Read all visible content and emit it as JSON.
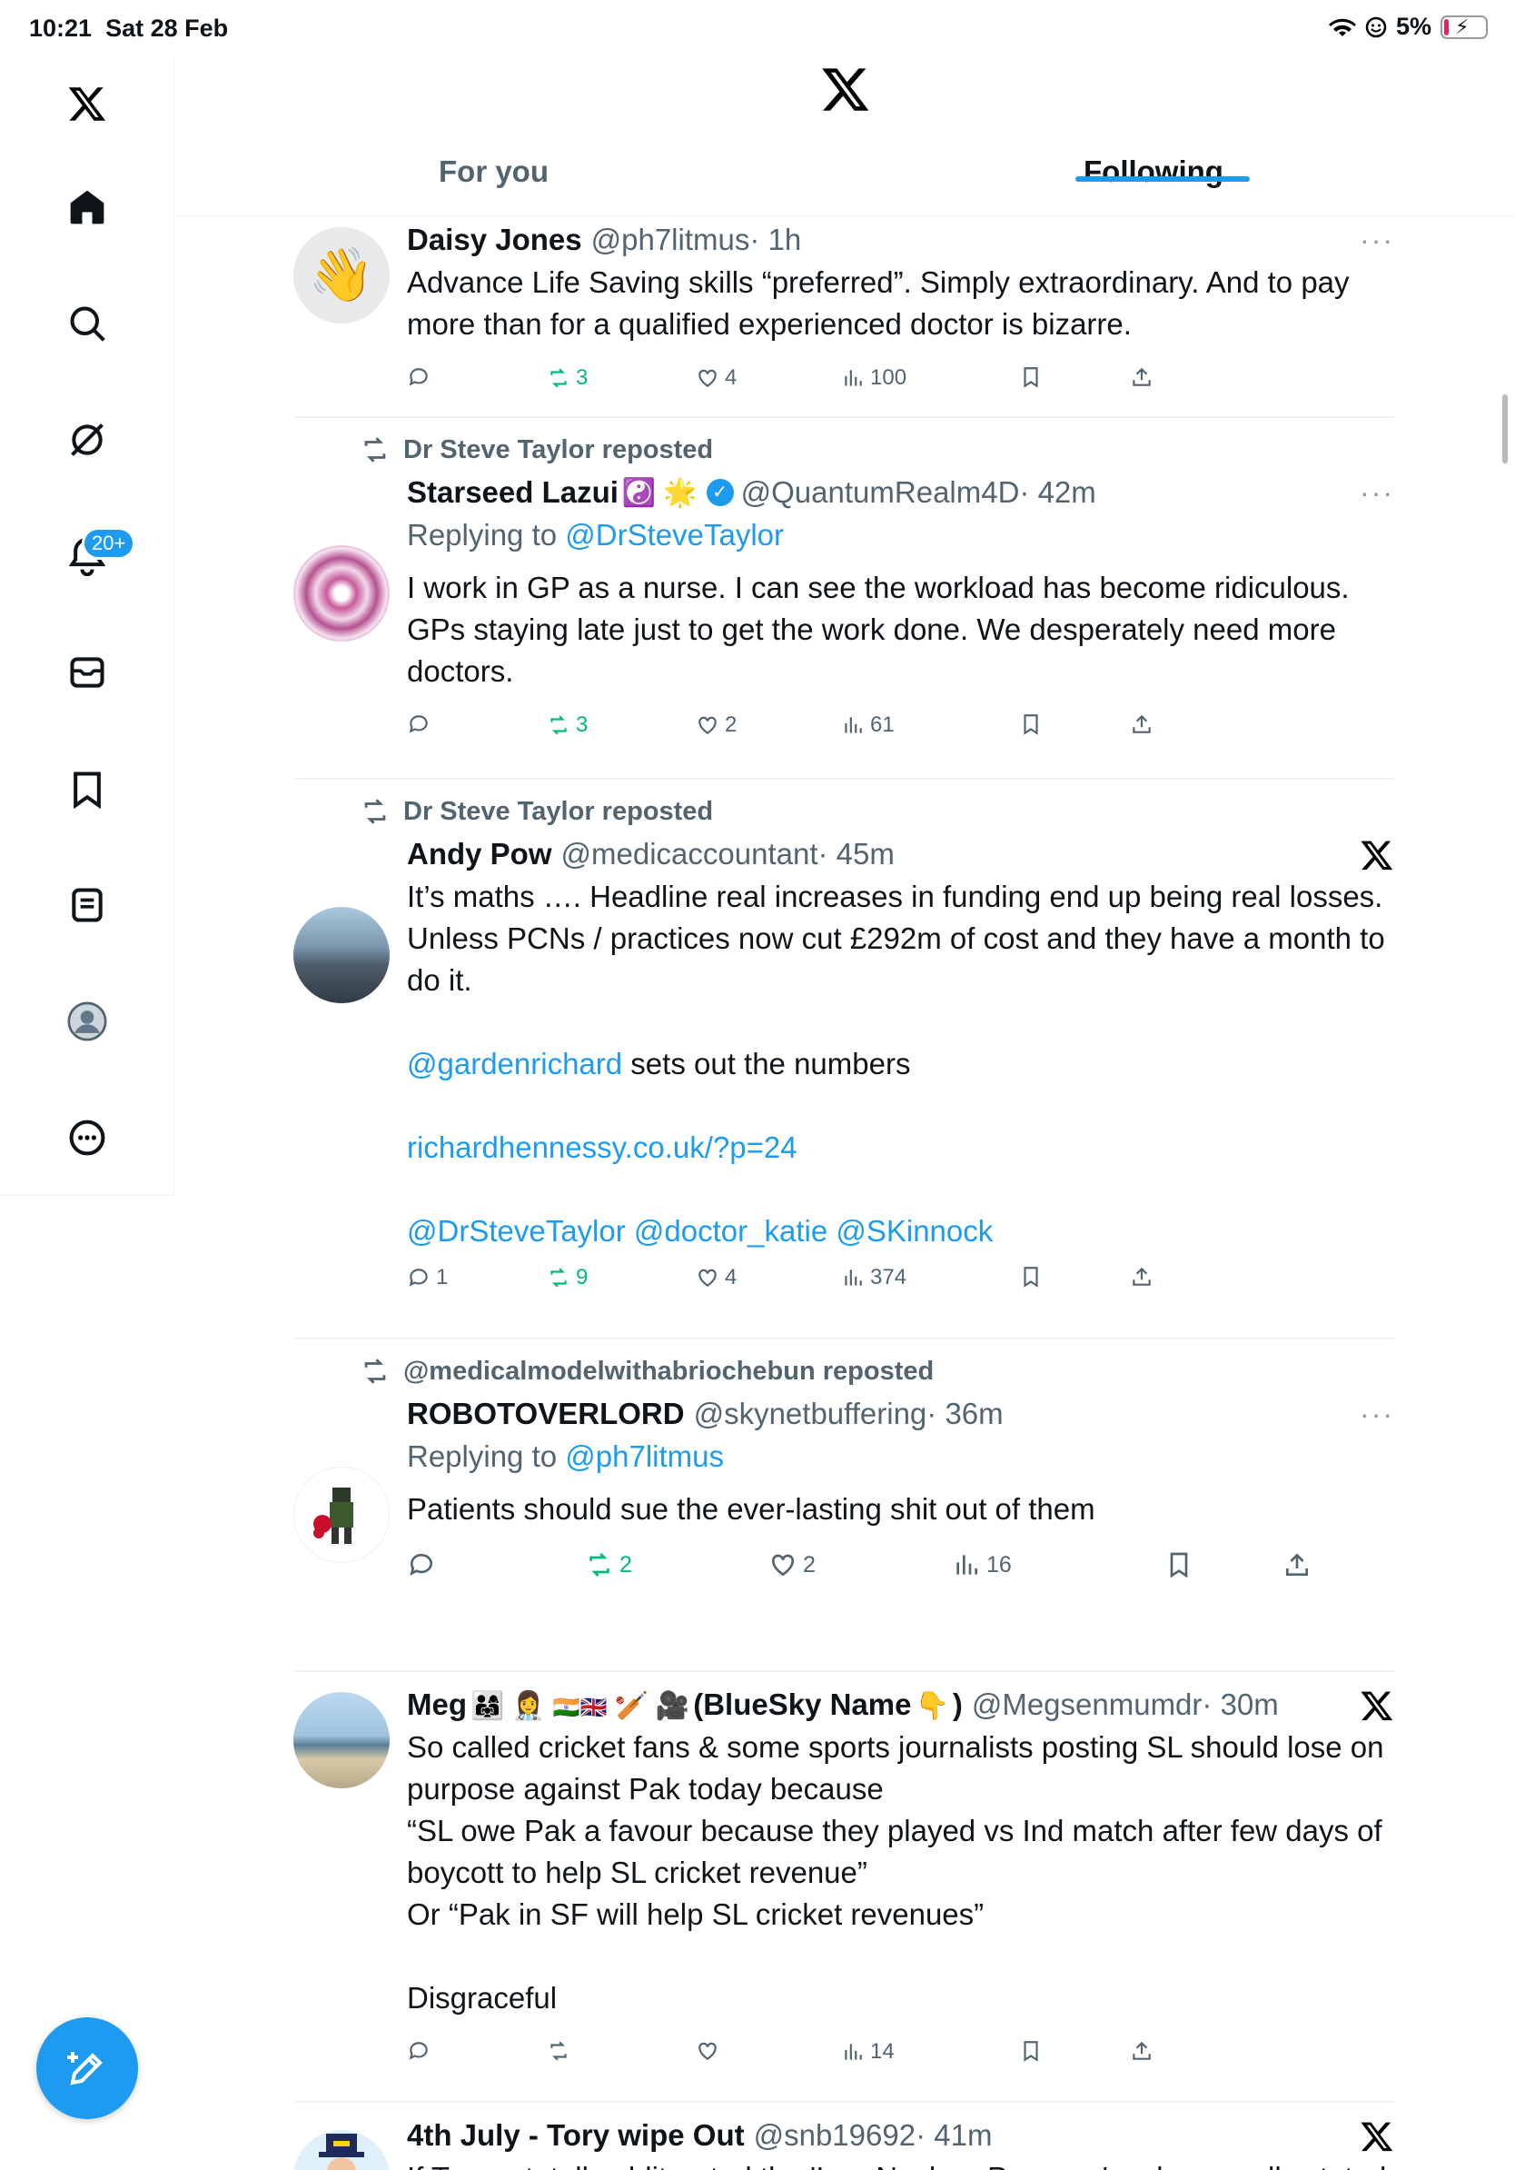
{
  "status": {
    "time": "10:21",
    "date": "Sat 28 Feb",
    "battery": "5%"
  },
  "sidebar": {
    "notif_badge": "20+",
    "icons": [
      "x-logo-icon",
      "home-icon",
      "search-icon",
      "grok-icon",
      "notifications-icon",
      "messages-icon",
      "bookmarks-icon",
      "lists-icon",
      "profile-icon",
      "more-icon"
    ]
  },
  "tabs": {
    "for_you": "For you",
    "following": "Following"
  },
  "posts": [
    {
      "name": "Daisy Jones",
      "handle": "@ph7litmus",
      "time": "· 1h",
      "text": "Advance Life Saving skills “preferred”.  Simply extraordinary. And to pay more than for a qualified experienced doctor is bizarre.",
      "replies": "",
      "reposts": "3",
      "likes": "4",
      "views": "100"
    },
    {
      "repost_by": "Dr Steve Taylor reposted",
      "name": "Starseed Lazui",
      "handle": "@QuantumRealm4D",
      "time": "· 42m",
      "reply_label": "Replying to ",
      "reply_to": "@DrSteveTaylor",
      "text": "I work in GP as a nurse. I can see the workload has become ridiculous. GPs staying late just to get the work done. We desperately need more doctors.",
      "replies": "",
      "reposts": "3",
      "likes": "2",
      "views": "61"
    },
    {
      "repost_by": "Dr Steve Taylor reposted",
      "name": "Andy Pow",
      "handle": "@medicaccountant",
      "time": "· 45m",
      "text": "It’s maths …. Headline real increases in funding end up being real losses. Unless PCNs / practices now cut £292m of cost and they have a month to do it.",
      "mention1": "@gardenrichard",
      "mention1_after": " sets out the numbers",
      "url": "richardhennessy.co.uk/?p=24",
      "mentions": "@DrSteveTaylor @doctor_katie @SKinnock",
      "replies": "1",
      "reposts": "9",
      "likes": "4",
      "views": "374"
    },
    {
      "repost_by": "@medicalmodelwithabriochebun reposted",
      "name": "ROBOTOVERLORD",
      "handle": "@skynetbuffering",
      "time": "· 36m",
      "reply_label": "Replying to ",
      "reply_to": "@ph7litmus",
      "text": "Patients should sue the ever-lasting shit out of them",
      "replies": "",
      "reposts": "2",
      "likes": "2",
      "views": "16"
    },
    {
      "name_prefix": "Meg",
      "name_suffix": "(BlueSky Name",
      "name_end": ")",
      "handle": "@Megsenmumdr",
      "time": "· 30m",
      "text1": "So called cricket fans & some sports journalists posting SL should lose on purpose against Pak today because",
      "text2": "“SL owe Pak a favour because they played vs Ind match after few days of boycott to help SL cricket revenue”",
      "text3": "Or “Pak in SF will help SL cricket revenues”",
      "text4": "Disgraceful",
      "replies": "",
      "reposts": "",
      "likes": "",
      "views": "14"
    },
    {
      "name": "4th July - Tory wipe Out",
      "handle": "@snb19692",
      "time": "· 41m",
      "text": "If Trump totally obliterated the 'Iran Nuclear Program' as he proudly stated a few months back, why are Netanyahu & Trump bombing the ?"
    }
  ]
}
